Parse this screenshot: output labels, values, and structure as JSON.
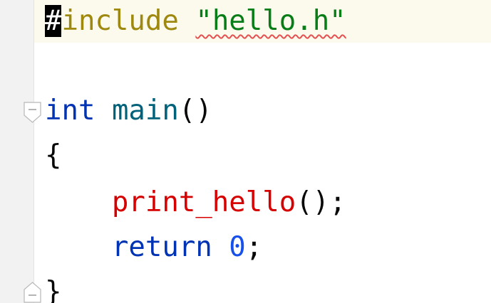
{
  "editor": {
    "lines": {
      "include": {
        "hash": "#",
        "directive": "include",
        "space": " ",
        "header": "\"hello.h\""
      },
      "main_decl": {
        "keyword": "int",
        "space": " ",
        "name": "main",
        "parens": "()"
      },
      "open_brace": "{",
      "print_call": {
        "indent": "    ",
        "name": "print_hello",
        "suffix": "();"
      },
      "return_stmt": {
        "indent": "    ",
        "keyword": "return",
        "space": " ",
        "value": "0",
        "semicolon": ";"
      },
      "close_brace": "}"
    },
    "colors": {
      "directive": "#9e880d",
      "string": "#067d17",
      "keyword": "#0033b3",
      "function": "#00627a",
      "call": "#d70000",
      "number": "#1750eb",
      "error_underline": "#e55050",
      "current_line": "#fcfaed",
      "gutter": "#f2f2f2"
    },
    "icons": [
      "fold-open-icon",
      "fold-close-icon"
    ]
  }
}
